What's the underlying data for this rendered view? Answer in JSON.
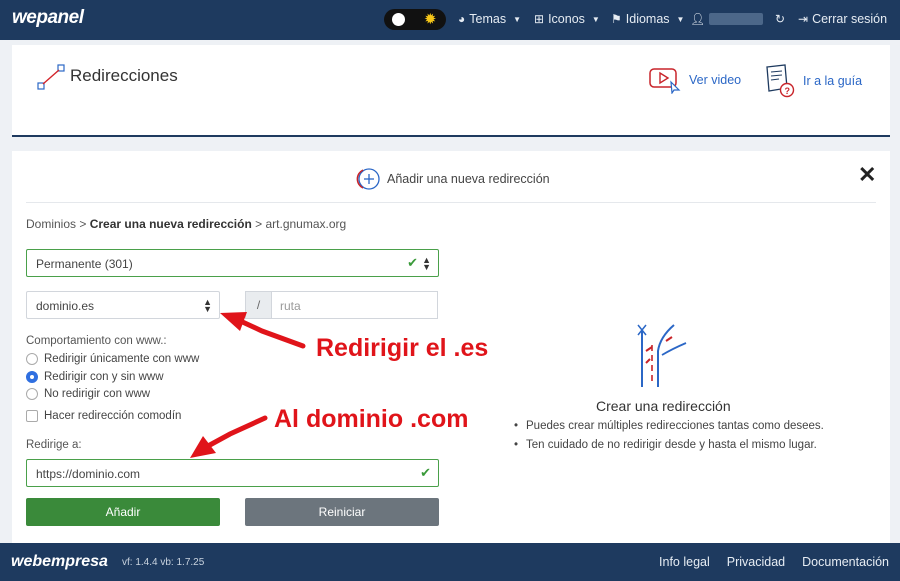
{
  "topbar": {
    "logo": "wepanel",
    "theme_label": "Temas",
    "icons_label": "Iconos",
    "languages_label": "Idiomas",
    "logout_label": "Cerrar sesión"
  },
  "header": {
    "title": "Redirecciones",
    "video_link": "Ver video",
    "guide_link": "Ir a la guía"
  },
  "form": {
    "add_heading": "Añadir una nueva redirección",
    "breadcrumb": {
      "root": "Dominios",
      "sep": ">",
      "current": "Crear una nueva redirección",
      "domain": "art.gnumax.org"
    },
    "redirect_type": "Permanente (301)",
    "domain_select": "dominio.es",
    "path_prefix": "/",
    "path_placeholder": "ruta",
    "www_label": "Comportamiento con www.:",
    "www_options": [
      {
        "label": "Redirigir únicamente con www",
        "selected": false
      },
      {
        "label": "Redirigir con y sin www",
        "selected": true
      },
      {
        "label": "No redirigir con www",
        "selected": false
      }
    ],
    "wildcard_label": "Hacer redirección comodín",
    "wildcard_checked": false,
    "target_label": "Redirige a:",
    "target_value": "https://dominio.com",
    "add_button": "Añadir",
    "reset_button": "Reiniciar"
  },
  "side": {
    "title": "Crear una redirección",
    "tips": [
      "Puedes crear múltiples redirecciones tantas como desees.",
      "Ten cuidado de no redirigir desde y hasta el mismo lugar."
    ]
  },
  "annotations": {
    "first": "Redirigir el .es",
    "second": "Al dominio .com",
    "color": "#e0141a"
  },
  "footer": {
    "logo": "webempresa",
    "version": "vf: 1.4.4 vb: 1.7.25",
    "links": [
      "Info legal",
      "Privacidad",
      "Documentación"
    ]
  },
  "colors": {
    "navbar": "#1e3a5f",
    "success": "#3a8a3a",
    "link": "#2b67c6"
  }
}
